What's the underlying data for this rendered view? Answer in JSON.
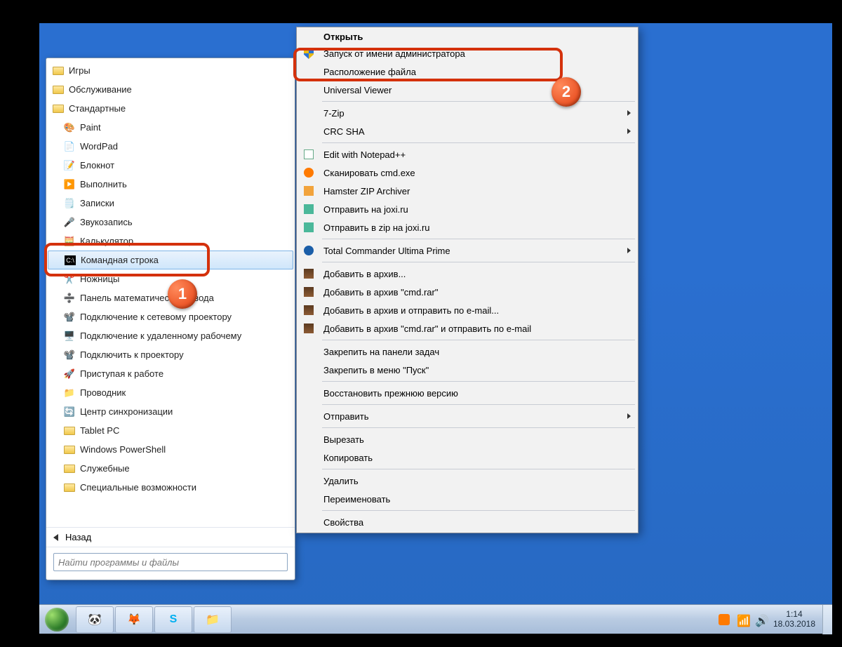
{
  "start_menu": {
    "folders": [
      "Игры",
      "Обслуживание",
      "Стандартные"
    ],
    "apps": [
      "Paint",
      "WordPad",
      "Блокнот",
      "Выполнить",
      "Записки",
      "Звукозапись",
      "Калькулятор",
      "Командная строка",
      "Ножницы",
      "Панель математического ввода",
      "Подключение к сетевому проектору",
      "Подключение к удаленному рабочему",
      "Подключить к проектору",
      "Приступая к работе",
      "Проводник",
      "Центр синхронизации"
    ],
    "subfolders": [
      "Tablet PC",
      "Windows PowerShell",
      "Служебные",
      "Специальные возможности"
    ],
    "back_label": "Назад",
    "search_placeholder": "Найти программы и файлы"
  },
  "context_menu": {
    "open": "Открыть",
    "run_as_admin": "Запуск от имени администратора",
    "section1": [
      "Расположение файла",
      "Universal Viewer"
    ],
    "submenus1": [
      "7-Zip",
      "CRC SHA"
    ],
    "section2": [
      "Edit with Notepad++",
      "Сканировать cmd.exe",
      "Hamster ZIP Archiver",
      "Отправить на joxi.ru",
      "Отправить в zip на joxi.ru"
    ],
    "total_commander": "Total Commander Ultima Prime",
    "archive": [
      "Добавить в архив...",
      "Добавить в архив \"cmd.rar\"",
      "Добавить в архив и отправить по e-mail...",
      "Добавить в архив \"cmd.rar\" и отправить по e-mail"
    ],
    "pin": [
      "Закрепить на панели задач",
      "Закрепить в меню \"Пуск\""
    ],
    "restore": "Восстановить прежнюю версию",
    "send_to": "Отправить",
    "cutcopy": [
      "Вырезать",
      "Копировать"
    ],
    "delrename": [
      "Удалить",
      "Переименовать"
    ],
    "properties": "Свойства"
  },
  "tray": {
    "time": "1:14",
    "date": "18.03.2018"
  },
  "badges": {
    "one": "1",
    "two": "2"
  }
}
